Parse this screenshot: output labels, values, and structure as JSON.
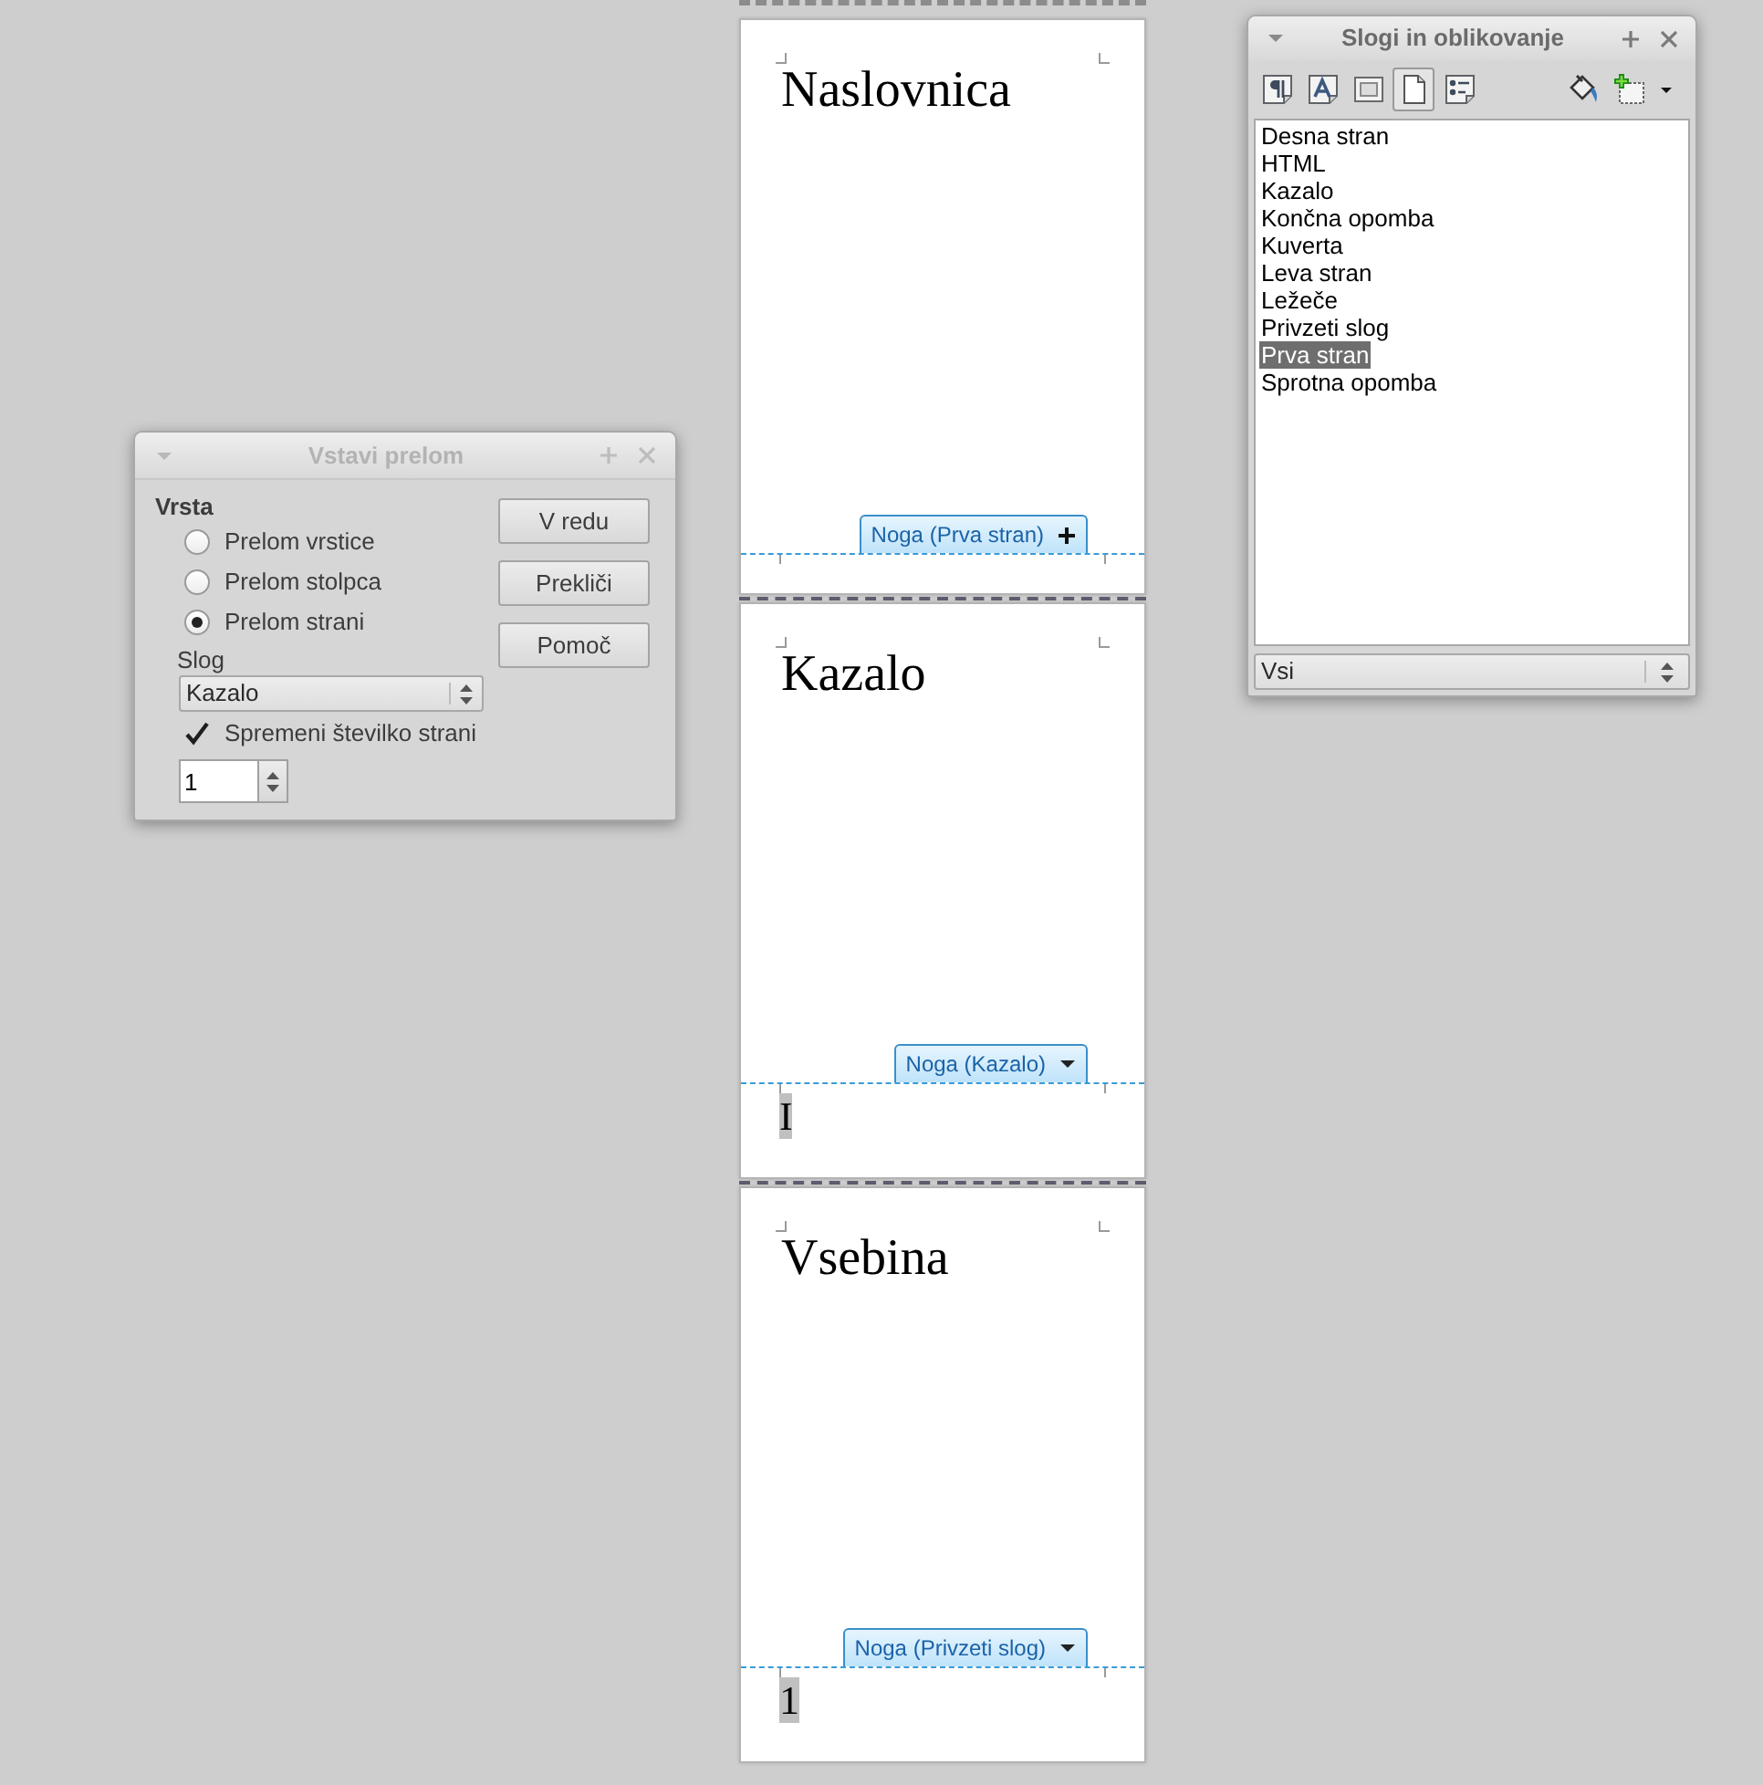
{
  "document": {
    "pages": [
      {
        "title": "Naslovnica",
        "footer_tab": {
          "label": "Noga (Prva stran)",
          "kind": "add"
        }
      },
      {
        "title": "Kazalo",
        "footer_tab": {
          "label": "Noga (Kazalo)",
          "kind": "menu"
        },
        "footer_field": "I"
      },
      {
        "title": "Vsebina",
        "footer_tab": {
          "label": "Noga (Privzeti slog)",
          "kind": "menu"
        },
        "footer_field": "1"
      }
    ]
  },
  "insert_break_dialog": {
    "title": "Vstavi prelom",
    "type_label": "Vrsta",
    "options": [
      {
        "label": "Prelom vrstice",
        "selected": false
      },
      {
        "label": "Prelom stolpca",
        "selected": false
      },
      {
        "label": "Prelom strani",
        "selected": true
      }
    ],
    "style_label": "Slog",
    "style": "Kazalo",
    "change_page_number": {
      "label": "Spremeni številko strani",
      "checked": true
    },
    "page_number": "1",
    "buttons": [
      "V redu",
      "Prekliči",
      "Pomoč"
    ]
  },
  "styles_panel": {
    "title": "Slogi in oblikovanje",
    "categories": [
      {
        "kind": "paragraph",
        "selected": false
      },
      {
        "kind": "character",
        "selected": false
      },
      {
        "kind": "frame",
        "selected": false
      },
      {
        "kind": "page",
        "selected": true
      },
      {
        "kind": "list",
        "selected": false
      }
    ],
    "styles": [
      {
        "label": "Desna stran",
        "selected": false
      },
      {
        "label": "HTML",
        "selected": false
      },
      {
        "label": "Kazalo",
        "selected": false
      },
      {
        "label": "Končna opomba",
        "selected": false
      },
      {
        "label": "Kuverta",
        "selected": false
      },
      {
        "label": "Leva stran",
        "selected": false
      },
      {
        "label": "Ležeče",
        "selected": false
      },
      {
        "label": "Privzeti slog",
        "selected": false
      },
      {
        "label": "Prva stran",
        "selected": true
      },
      {
        "label": "Sprotna opomba",
        "selected": false
      }
    ],
    "filter": "Vsi"
  }
}
